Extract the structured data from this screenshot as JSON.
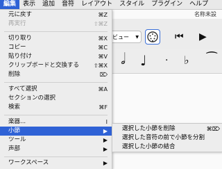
{
  "menubar": {
    "items": [
      "編集",
      "表示",
      "追加",
      "音符",
      "レイアウト",
      "スタイル",
      "プラグイン",
      "ヘルプ"
    ]
  },
  "app": {
    "doc_title": "名称未設",
    "view_select": "ビュー"
  },
  "edit_menu": {
    "items": [
      {
        "label": "元に戻す",
        "shortcut": "⌘Z"
      },
      {
        "label": "再実行",
        "shortcut": "⇧⌘Z"
      },
      {
        "label": "切り取り",
        "shortcut": "⌘X"
      },
      {
        "label": "コピー",
        "shortcut": "⌘C"
      },
      {
        "label": "貼り付け",
        "shortcut": "⌘V"
      },
      {
        "label": "クリップボードと交換する",
        "shortcut": "⇧⌘X"
      },
      {
        "label": "削除",
        "shortcut": "⌦"
      },
      {
        "label": "すべて選択",
        "shortcut": "⌘A"
      },
      {
        "label": "セクションの選択",
        "shortcut": ""
      },
      {
        "label": "検索",
        "shortcut": "⌘F"
      },
      {
        "label": "楽器...",
        "shortcut": "I"
      },
      {
        "label": "小節",
        "shortcut": "▶"
      },
      {
        "label": "ツール",
        "shortcut": "▶"
      },
      {
        "label": "声部",
        "shortcut": "▶"
      },
      {
        "label": "ワークスペース",
        "shortcut": "▶"
      }
    ]
  },
  "measure_submenu": {
    "items": [
      {
        "label": "選択した小節を削除",
        "shortcut": "⌘⌦"
      },
      {
        "label": "選択した音符の前で小節を分割",
        "shortcut": ""
      },
      {
        "label": "選択した小節の結合",
        "shortcut": ""
      }
    ]
  },
  "colors": {
    "highlight": "#2f62d6",
    "menu_bg": "#ededed",
    "disabled_text": "#a4a4a4"
  }
}
